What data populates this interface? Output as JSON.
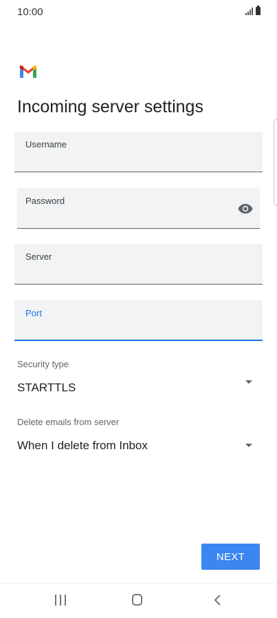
{
  "status_bar": {
    "time": "10:00"
  },
  "page": {
    "title": "Incoming server settings"
  },
  "fields": {
    "username": {
      "label": "Username",
      "value": ""
    },
    "password": {
      "label": "Password",
      "value": ""
    },
    "server": {
      "label": "Server",
      "value": ""
    },
    "port": {
      "label": "Port",
      "value": ""
    }
  },
  "security_type": {
    "label": "Security type",
    "value": "STARTTLS"
  },
  "delete_emails": {
    "label": "Delete emails from server",
    "value": "When I delete from Inbox"
  },
  "actions": {
    "next_label": "NEXT"
  },
  "colors": {
    "accent": "#1a73e8",
    "button": "#3b86f0",
    "field_bg": "#f1f3f4"
  },
  "icons": {
    "logo": "gmail-icon",
    "password_toggle": "eye-icon",
    "nav_recents": "recents-icon",
    "nav_home": "home-icon",
    "nav_back": "back-icon"
  }
}
